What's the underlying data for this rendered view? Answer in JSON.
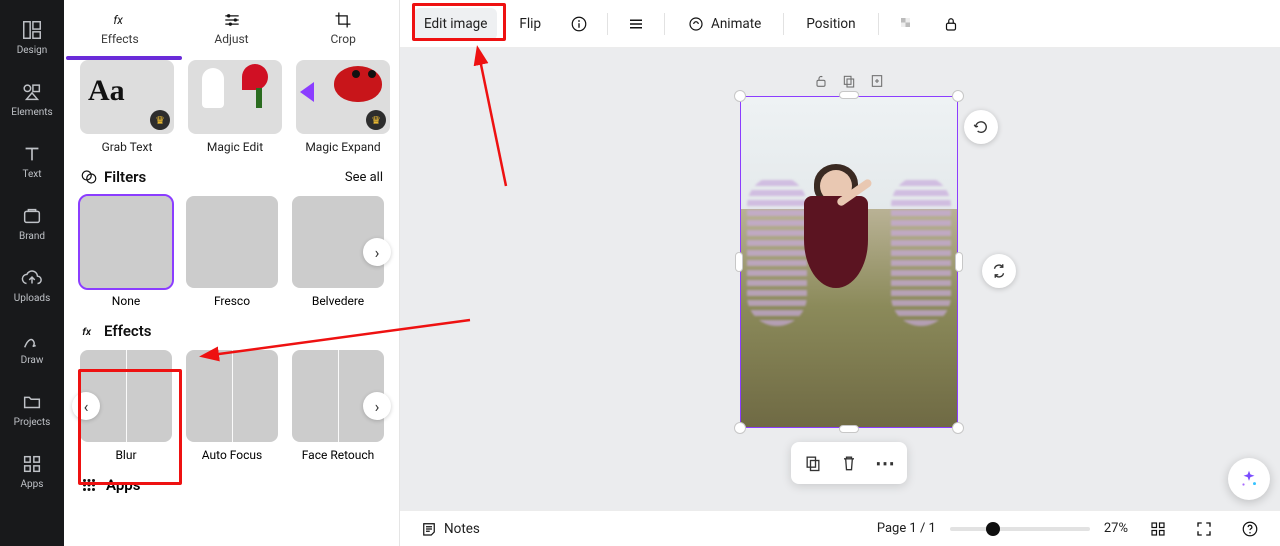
{
  "leftNav": [
    {
      "id": "design",
      "label": "Design"
    },
    {
      "id": "elements",
      "label": "Elements"
    },
    {
      "id": "text",
      "label": "Text"
    },
    {
      "id": "brand",
      "label": "Brand"
    },
    {
      "id": "uploads",
      "label": "Uploads"
    },
    {
      "id": "draw",
      "label": "Draw"
    },
    {
      "id": "projects",
      "label": "Projects"
    },
    {
      "id": "apps",
      "label": "Apps"
    }
  ],
  "panel": {
    "tabs": {
      "effects": "Effects",
      "adjust": "Adjust",
      "crop": "Crop",
      "active": "effects"
    },
    "topTools": [
      {
        "label": "Grab Text",
        "premium": true
      },
      {
        "label": "Magic Edit",
        "premium": false
      },
      {
        "label": "Magic Expand",
        "premium": true
      }
    ],
    "filters": {
      "title": "Filters",
      "see_all": "See all",
      "items": [
        {
          "label": "None",
          "selected": true
        },
        {
          "label": "Fresco",
          "selected": false
        },
        {
          "label": "Belvedere",
          "selected": false
        }
      ]
    },
    "effects": {
      "title": "Effects",
      "items": [
        {
          "label": "Blur"
        },
        {
          "label": "Auto Focus"
        },
        {
          "label": "Face Retouch"
        }
      ]
    },
    "apps_title": "Apps"
  },
  "toolbar": {
    "edit_image": "Edit image",
    "flip": "Flip",
    "animate": "Animate",
    "position": "Position"
  },
  "context": {},
  "status": {
    "notes": "Notes",
    "page": "Page 1 / 1",
    "zoom": "27%"
  }
}
